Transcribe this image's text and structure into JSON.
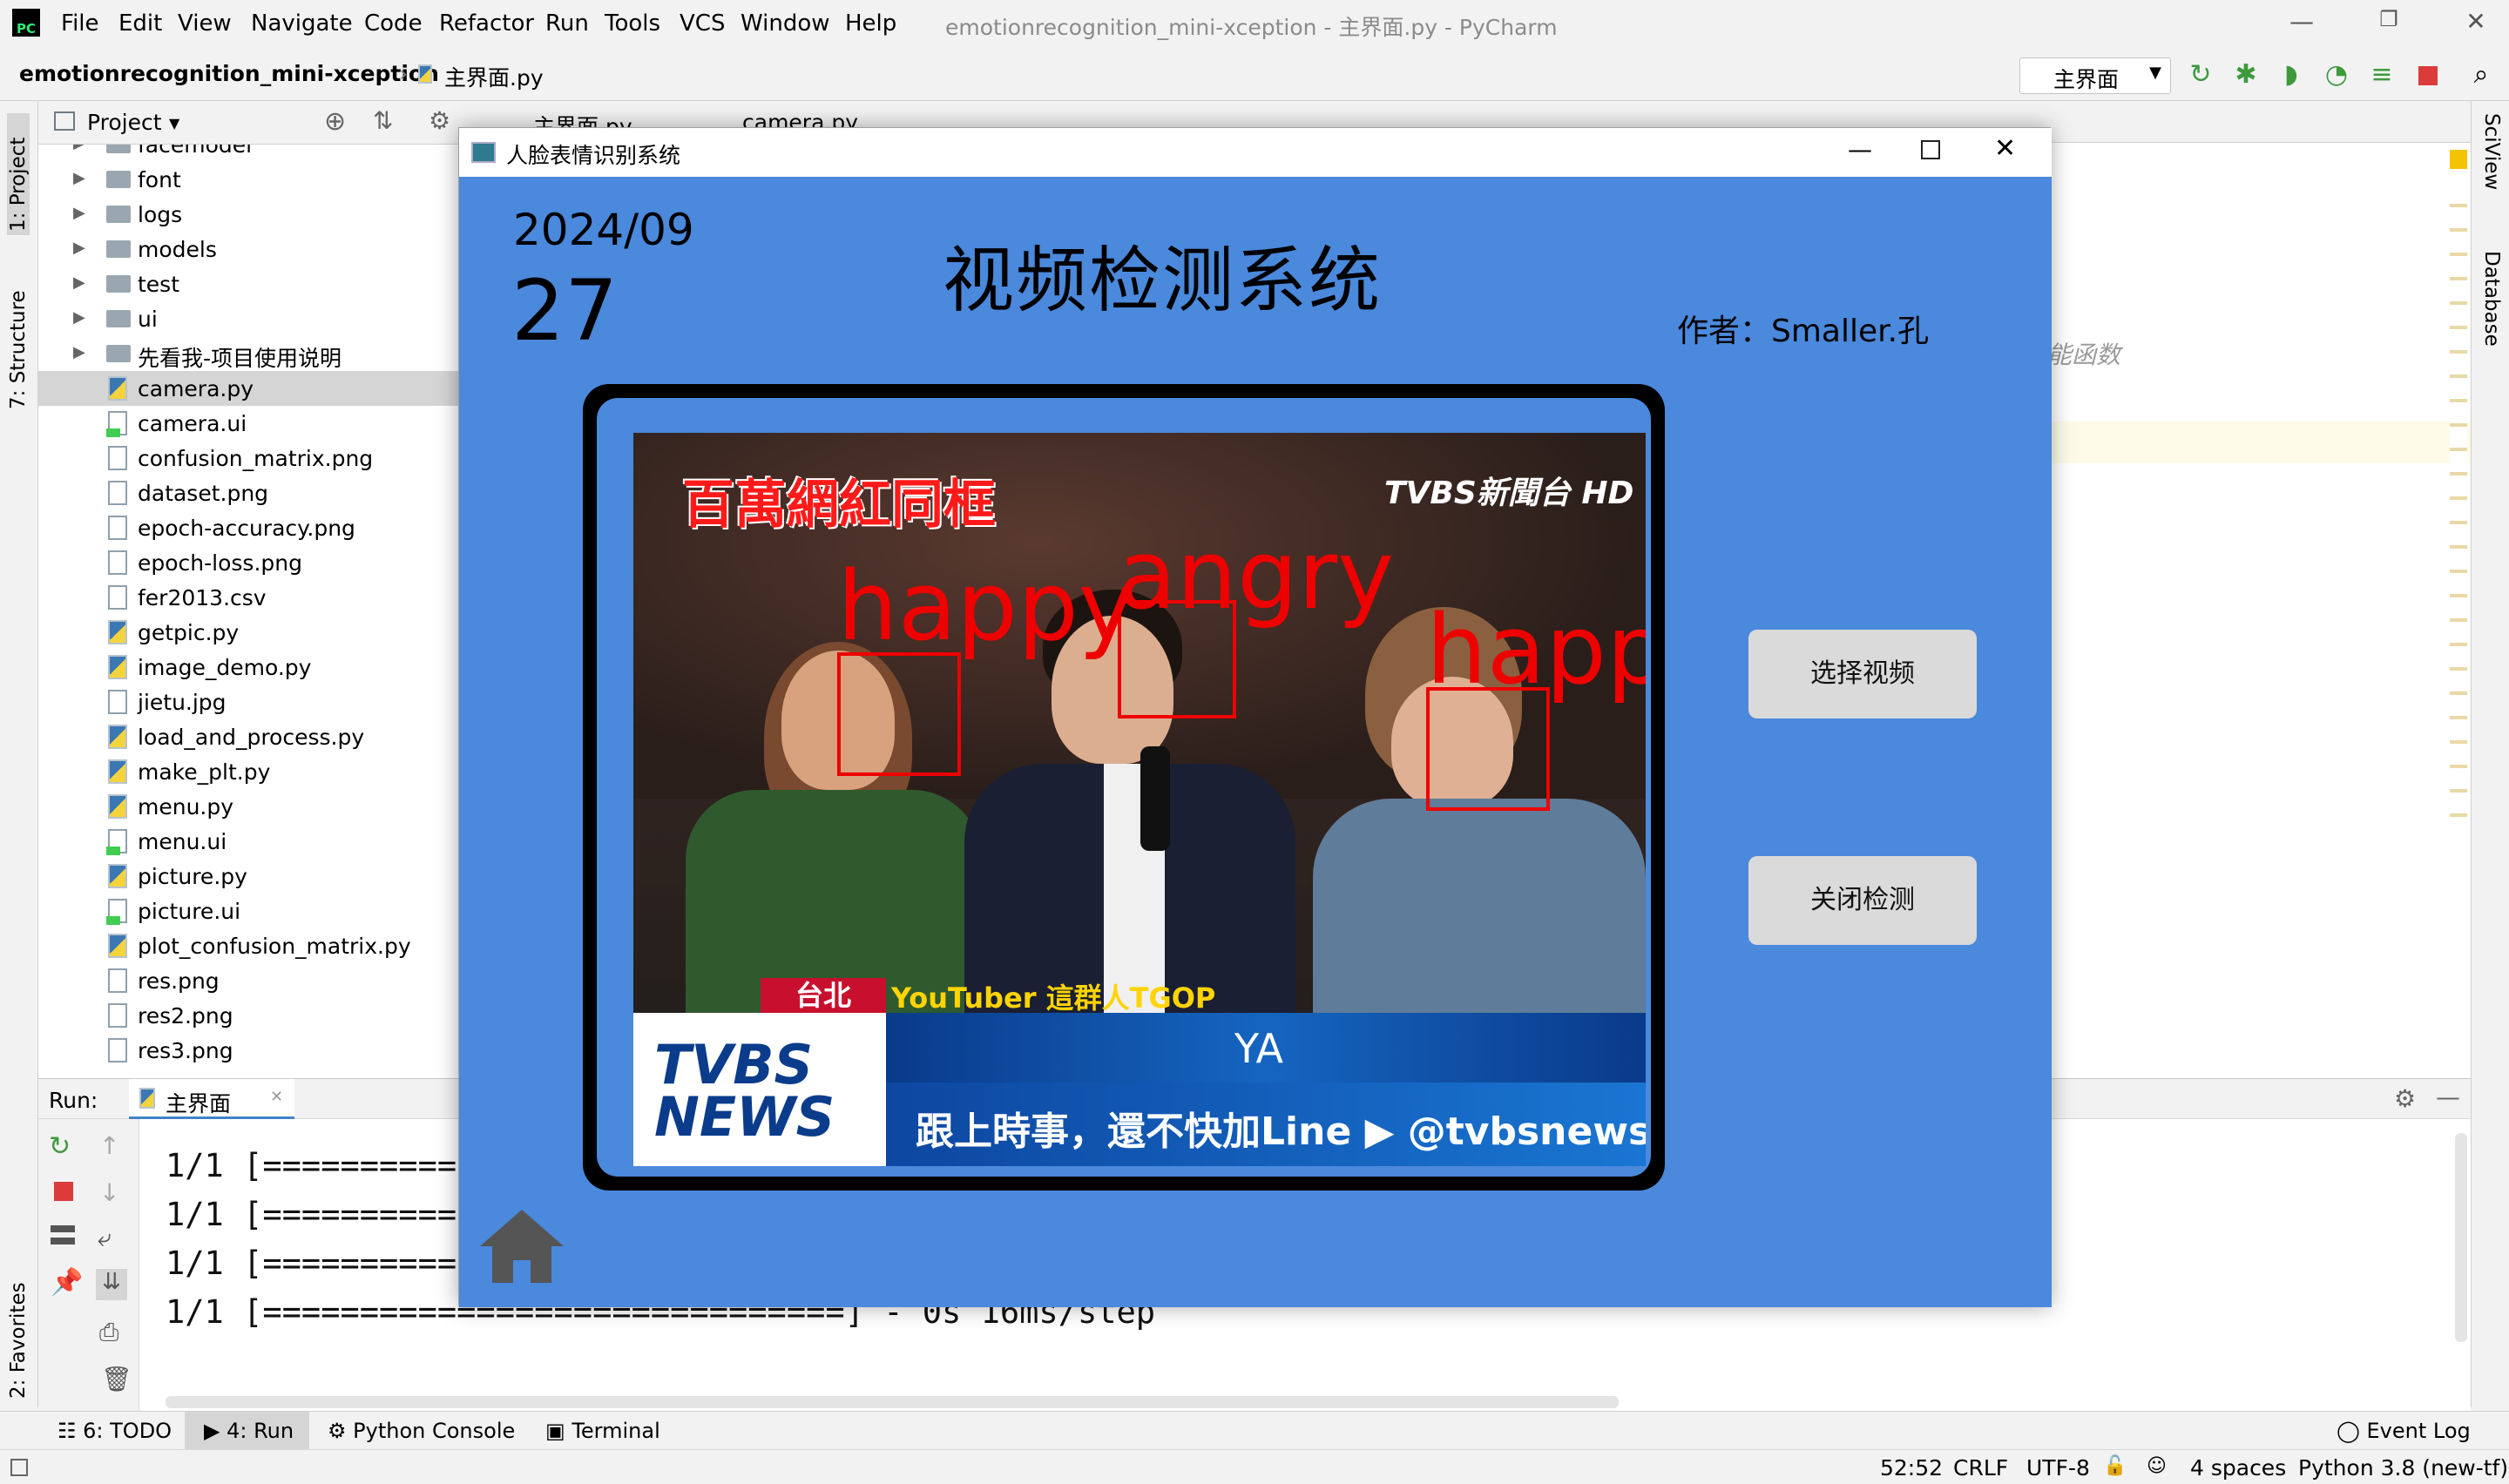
{
  "menubar": {
    "items": [
      "File",
      "Edit",
      "View",
      "Navigate",
      "Code",
      "Refactor",
      "Run",
      "Tools",
      "VCS",
      "Window",
      "Help"
    ],
    "window_title": "emotionrecognition_mini-xception - 主界面.py - PyCharm",
    "logo": "PC"
  },
  "navbar": {
    "project": "emotionrecognition_mini-xception",
    "file": "主界面.py",
    "run_config": "主界面"
  },
  "left_strip": {
    "project_tab": "1: Project",
    "structure_tab": "7: Structure",
    "favorites_tab": "2: Favorites"
  },
  "right_strip": {
    "sciview_tab": "SciView",
    "database_tab": "Database"
  },
  "project_panel": {
    "title": "Project",
    "partial_top": "facemodel",
    "items": [
      {
        "label": "font",
        "type": "folder"
      },
      {
        "label": "logs",
        "type": "folder"
      },
      {
        "label": "models",
        "type": "folder"
      },
      {
        "label": "test",
        "type": "folder"
      },
      {
        "label": "ui",
        "type": "folder"
      },
      {
        "label": "先看我-项目使用说明",
        "type": "folder"
      },
      {
        "label": "camera.py",
        "type": "py"
      },
      {
        "label": "camera.ui",
        "type": "ui"
      },
      {
        "label": "confusion_matrix.png",
        "type": "img"
      },
      {
        "label": "dataset.png",
        "type": "img"
      },
      {
        "label": "epoch-accuracy.png",
        "type": "img"
      },
      {
        "label": "epoch-loss.png",
        "type": "img"
      },
      {
        "label": "fer2013.csv",
        "type": "csv"
      },
      {
        "label": "getpic.py",
        "type": "py"
      },
      {
        "label": "image_demo.py",
        "type": "py"
      },
      {
        "label": "jietu.jpg",
        "type": "img"
      },
      {
        "label": "load_and_process.py",
        "type": "py"
      },
      {
        "label": "make_plt.py",
        "type": "py"
      },
      {
        "label": "menu.py",
        "type": "py"
      },
      {
        "label": "menu.ui",
        "type": "ui"
      },
      {
        "label": "picture.py",
        "type": "py"
      },
      {
        "label": "picture.ui",
        "type": "ui"
      },
      {
        "label": "plot_confusion_matrix.py",
        "type": "py"
      },
      {
        "label": "res.png",
        "type": "img"
      },
      {
        "label": "res2.png",
        "type": "img"
      },
      {
        "label": "res3.png",
        "type": "img"
      }
    ]
  },
  "editor_tabs": [
    "主界面.py",
    "camera.py"
  ],
  "editor_comment": "能函数",
  "run_panel": {
    "label": "Run:",
    "tab": "主界面",
    "lines": [
      "1/1 [==========",
      "1/1 [==========",
      "1/1 [==========",
      "1/1 [==============================] - 0s 16ms/step"
    ]
  },
  "bottom_tabs": [
    "6: TODO",
    "4: Run",
    "Python Console",
    "Terminal"
  ],
  "event_log": "Event Log",
  "status": {
    "position": "52:52",
    "line_sep": "CRLF",
    "encoding": "UTF-8",
    "indent": "4 spaces",
    "interpreter": "Python 3.8 (new-tf)"
  },
  "app_window": {
    "title": "人脸表情识别系统",
    "date_ym": "2024/09",
    "date_d": "27",
    "heading": "视频检测系统",
    "author": "作者：Smaller.孔",
    "select_btn": "选择视频",
    "close_btn": "关闭检测"
  },
  "video": {
    "overlay_title": "百萬網紅同框",
    "channel": "TVBS新聞台 HD",
    "location": "台北",
    "caption": "YouTuber 這群人TGOP",
    "name": "YA",
    "news_logo": "TVBS NEWS",
    "ticker": "跟上時事，還不快加Line ▶ @tvbsnews",
    "emotions": [
      "happy",
      "angry",
      "happ"
    ]
  },
  "colors": {
    "app_bg": "#4a89dc",
    "detect_red": "#e00000",
    "ide_bg": "#f2f2f2"
  }
}
